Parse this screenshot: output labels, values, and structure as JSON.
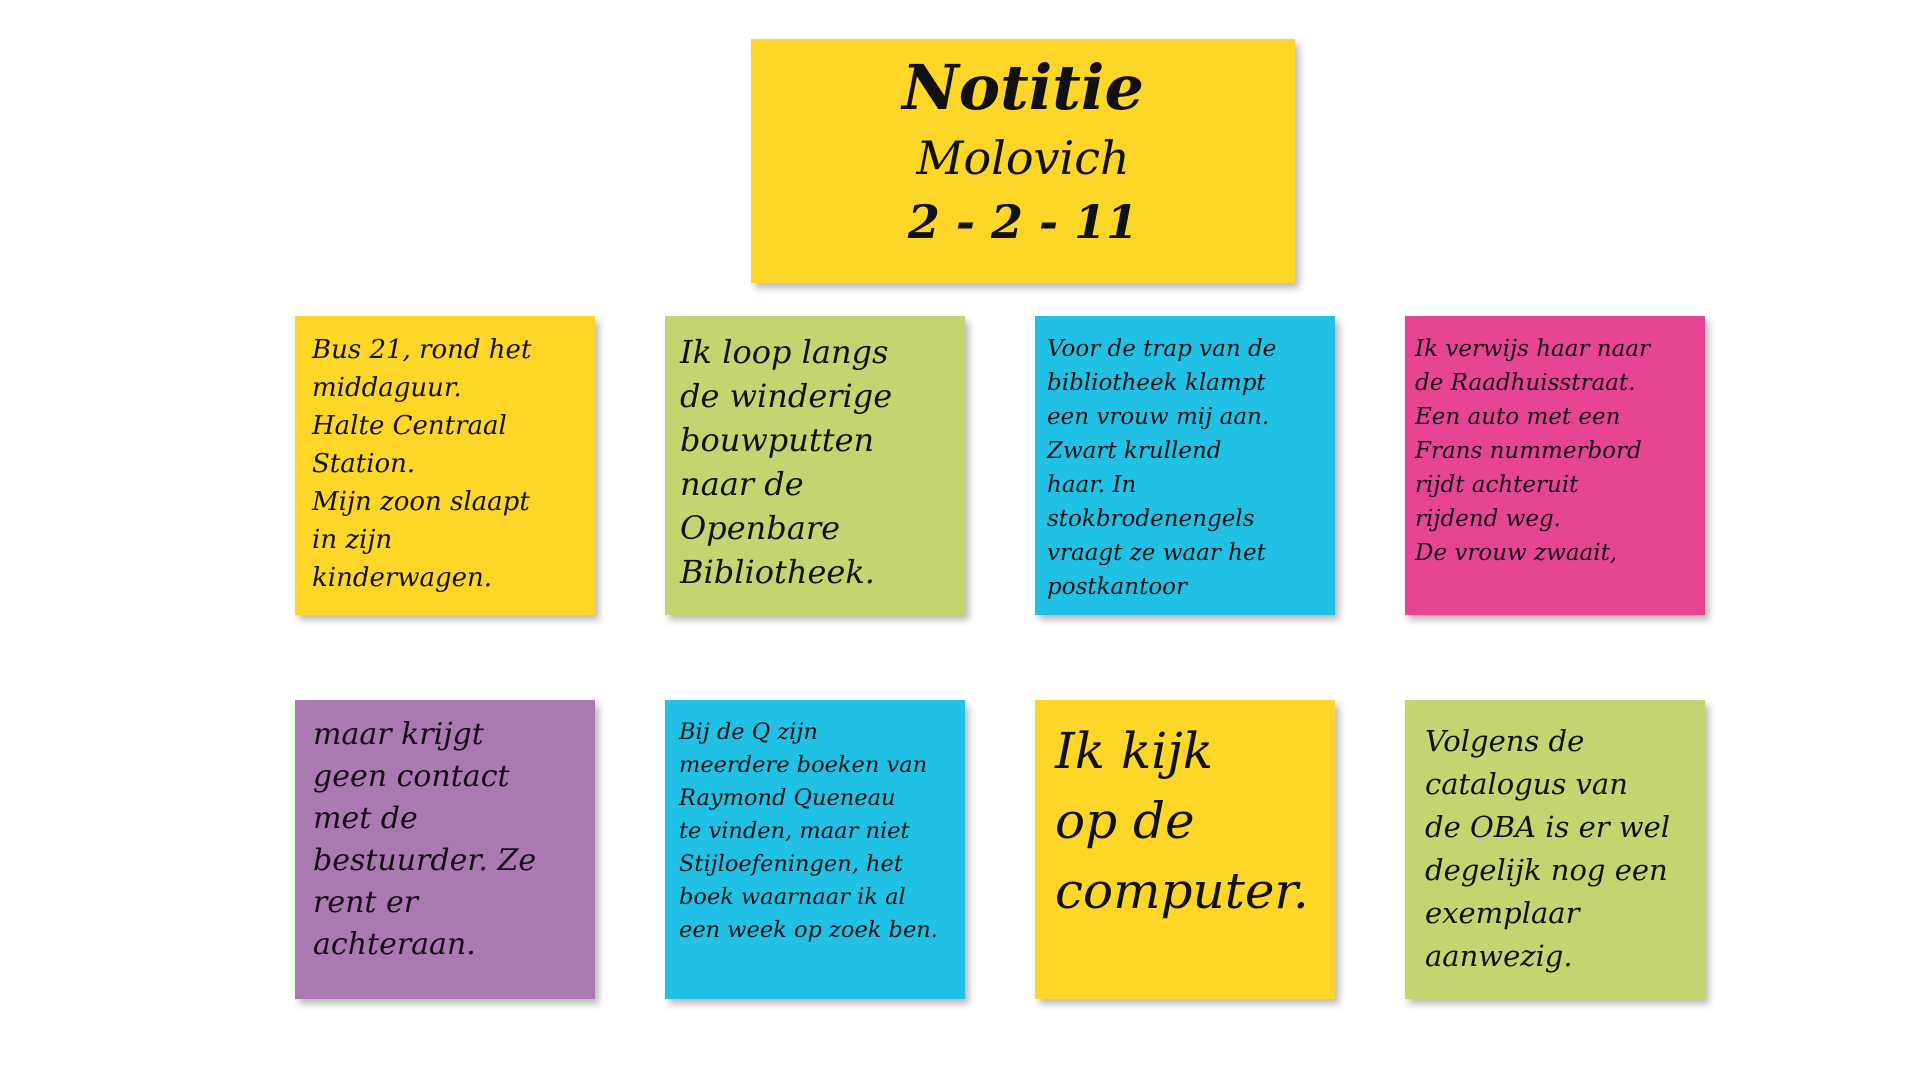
{
  "colors": {
    "yellow": "#fdd628",
    "green": "#c5d46e",
    "cyan": "#21c1e5",
    "pink": "#e84494",
    "purple": "#ab79b2"
  },
  "title_note": {
    "title": "Notitie",
    "name": "Molovich",
    "date": "2 - 2 - 11",
    "color": "#fdd628"
  },
  "notes": [
    {
      "text": "Bus 21, rond het\nmiddaguur.\nHalte Centraal\nStation.\nMijn zoon slaapt\nin zijn\nkinderwagen.",
      "color": "#fdd628"
    },
    {
      "text": "Ik loop langs\nde winderige\nbouwputten\nnaar de\nOpenbare\nBibliotheek.",
      "color": "#c5d46e"
    },
    {
      "text": "Voor de trap van de\nbibliotheek klampt\neen vrouw mij aan.\nZwart krullend\nhaar. In\nstokbrodenengels\nvraagt ze waar het\npostkantoor",
      "color": "#21c1e5"
    },
    {
      "text": "Ik verwijs haar naar\nde Raadhuisstraat.\nEen auto met een\nFrans nummerbord\nrijdt achteruit\nrijdend weg.\nDe vrouw zwaait,",
      "color": "#e84494"
    },
    {
      "text": "maar krijgt\ngeen contact\nmet de\nbestuurder. Ze\nrent er\nachteraan.",
      "color": "#ab79b2"
    },
    {
      "text": "Bij de Q zijn\nmeerdere boeken van\nRaymond Queneau\nte vinden, maar niet\nStijloefeningen, het\nboek waarnaar ik al\neen week op zoek ben.",
      "color": "#21c1e5"
    },
    {
      "text": "Ik kijk\nop de\ncomputer.",
      "color": "#fdd628"
    },
    {
      "text": "Volgens de\ncatalogus van\nde OBA is er wel\ndegelijk nog een\nexemplaar\naanwezig.",
      "color": "#c5d46e"
    }
  ]
}
